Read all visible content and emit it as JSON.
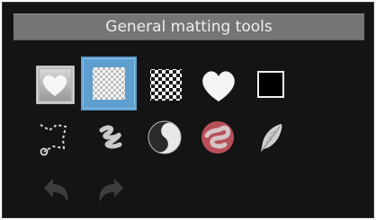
{
  "panel": {
    "title": "General matting tools"
  },
  "tools": {
    "row1": [
      {
        "name": "heart-mask-tool",
        "icon": "heart-on-gray-icon",
        "selected": false
      },
      {
        "name": "transparency-grid-tool",
        "icon": "checker-fine-icon",
        "selected": true
      },
      {
        "name": "checker-board-tool",
        "icon": "checker-coarse-icon",
        "selected": false
      },
      {
        "name": "white-heart-tool",
        "icon": "white-heart-icon",
        "selected": false
      },
      {
        "name": "black-square-tool",
        "icon": "black-square-icon",
        "selected": false
      }
    ],
    "row2": [
      {
        "name": "path-select-tool",
        "icon": "dotted-path-icon"
      },
      {
        "name": "smudge-brush-tool",
        "icon": "scribble-brush-icon"
      },
      {
        "name": "yin-yang-tool",
        "icon": "yin-yang-icon"
      },
      {
        "name": "red-blob-tool",
        "icon": "red-blob-icon"
      },
      {
        "name": "feather-tool",
        "icon": "feather-icon"
      }
    ],
    "row3": [
      {
        "name": "undo-button",
        "icon": "undo-arrow-icon",
        "enabled": false
      },
      {
        "name": "redo-button",
        "icon": "redo-arrow-icon",
        "enabled": false
      }
    ]
  },
  "colors": {
    "panel_bg": "#141414",
    "header_bg": "#757575",
    "selected_accent": "#5e9fd0",
    "blob_red": "#b8505a"
  }
}
